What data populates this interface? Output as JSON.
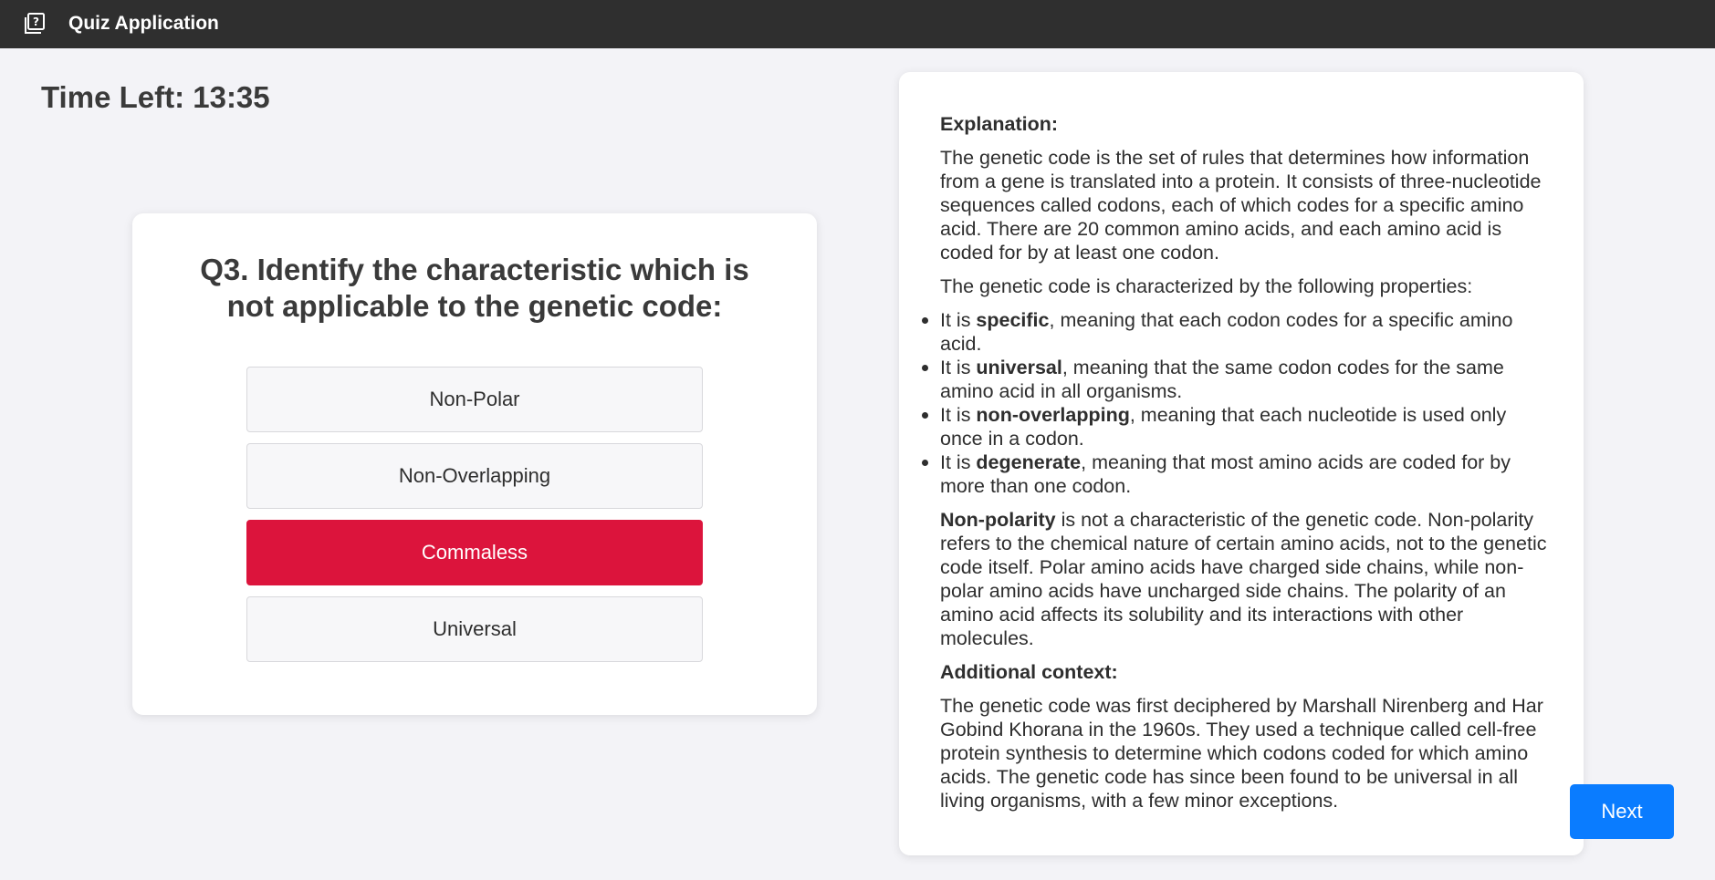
{
  "header": {
    "title": "Quiz Application",
    "icon": "quiz-icon"
  },
  "timer": {
    "text": "Time Left: 13:35"
  },
  "question": {
    "text": "Q3. Identify the characteristic which is not applicable to the genetic code:",
    "options": [
      {
        "label": "Non-Polar",
        "selected": false
      },
      {
        "label": "Non-Overlapping",
        "selected": false
      },
      {
        "label": "Commaless",
        "selected": true
      },
      {
        "label": "Universal",
        "selected": false
      }
    ]
  },
  "explanation": {
    "heading": "Explanation:",
    "para1": "The genetic code is the set of rules that determines how information from a gene is translated into a protein. It consists of three-nucleotide sequences called codons, each of which codes for a specific amino acid. There are 20 common amino acids, and each amino acid is coded for by at least one codon.",
    "para2": "The genetic code is characterized by the following properties:",
    "properties": [
      {
        "prefix": "It is ",
        "term": "specific",
        "rest": ", meaning that each codon codes for a specific amino acid."
      },
      {
        "prefix": "It is ",
        "term": "universal",
        "rest": ", meaning that the same codon codes for the same amino acid in all organisms."
      },
      {
        "prefix": "It is ",
        "term": "non-overlapping",
        "rest": ", meaning that each nucleotide is used only once in a codon."
      },
      {
        "prefix": "It is ",
        "term": "degenerate",
        "rest": ", meaning that most amino acids are coded for by more than one codon."
      }
    ],
    "para3_term": "Non-polarity",
    "para3_rest": " is not a characteristic of the genetic code. Non-polarity refers to the chemical nature of certain amino acids, not to the genetic code itself. Polar amino acids have charged side chains, while non-polar amino acids have uncharged side chains. The polarity of an amino acid affects its solubility and its interactions with other molecules.",
    "context_heading": "Additional context:",
    "context_text": "The genetic code was first deciphered by Marshall Nirenberg and Har Gobind Khorana in the 1960s. They used a technique called cell-free protein synthesis to determine which codons coded for which amino acids. The genetic code has since been found to be universal in all living organisms, with a few minor exceptions."
  },
  "controls": {
    "next_label": "Next"
  },
  "colors": {
    "header_bg": "#2f2f2f",
    "selected_option": "#dc143c",
    "next_button": "#0a7cff"
  }
}
